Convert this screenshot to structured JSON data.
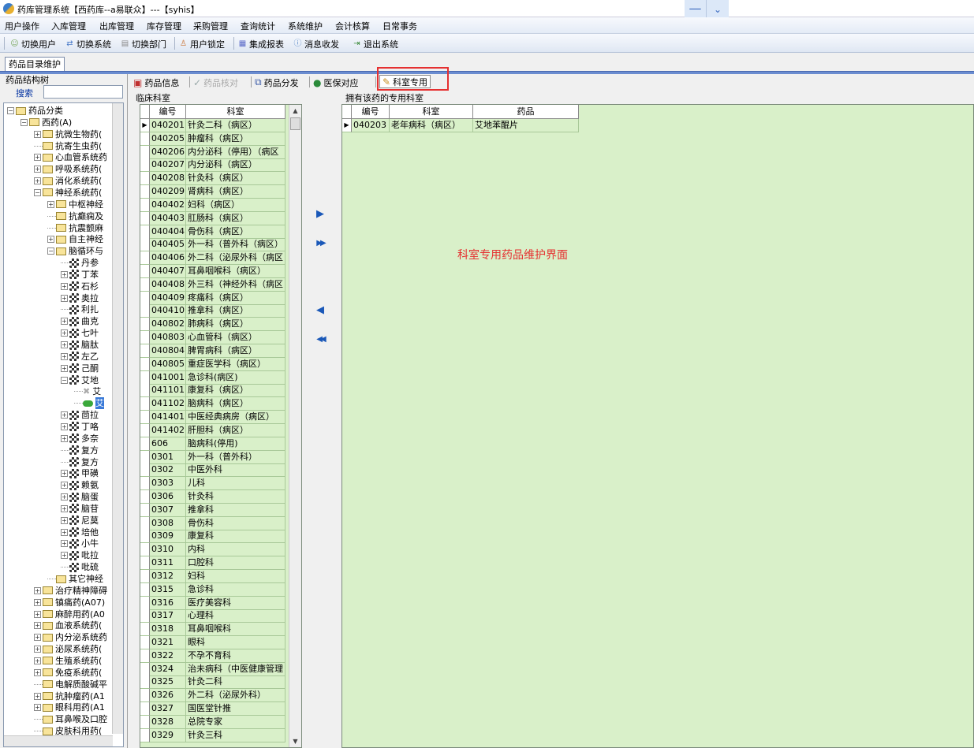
{
  "window": {
    "title": "药库管理系统【西药库--a易联众】---【syhis】",
    "minimize_glyph": "—",
    "dropdown_glyph": "⌄"
  },
  "menubar": {
    "items": [
      "用户操作",
      "入库管理",
      "出库管理",
      "库存管理",
      "采购管理",
      "查询统计",
      "系统维护",
      "会计核算",
      "日常事务"
    ]
  },
  "toolbar": {
    "items": [
      {
        "label": "切换用户",
        "icon": "users-icon"
      },
      {
        "label": "切换系统",
        "icon": "switch-system-icon"
      },
      {
        "label": "切换部门",
        "icon": "department-icon"
      },
      {
        "label": "用户锁定",
        "icon": "lock-user-icon"
      },
      {
        "label": "集成报表",
        "icon": "report-icon"
      },
      {
        "label": "消息收发",
        "icon": "message-icon"
      },
      {
        "label": "退出系统",
        "icon": "exit-icon"
      }
    ]
  },
  "doc_tab": {
    "label": "药品目录维护"
  },
  "tree": {
    "title": "药品结构树",
    "search_label": "搜索",
    "search_value": "",
    "nodes": [
      {
        "label": "药品分类",
        "level": 0,
        "expander": "−",
        "icon": "folder"
      },
      {
        "label": "西药(A)",
        "level": 1,
        "expander": "−",
        "icon": "folder"
      },
      {
        "label": "抗微生物药(",
        "level": 2,
        "expander": "+",
        "icon": "folder"
      },
      {
        "label": "抗寄生虫药(",
        "level": 2,
        "expander": "",
        "icon": "folder"
      },
      {
        "label": "心血管系统药",
        "level": 2,
        "expander": "+",
        "icon": "folder"
      },
      {
        "label": "呼吸系统药(",
        "level": 2,
        "expander": "+",
        "icon": "folder"
      },
      {
        "label": "消化系统药(",
        "level": 2,
        "expander": "+",
        "icon": "folder"
      },
      {
        "label": "神经系统药(",
        "level": 2,
        "expander": "−",
        "icon": "folder"
      },
      {
        "label": "中枢神经",
        "level": 3,
        "expander": "+",
        "icon": "folder"
      },
      {
        "label": "抗癫痫及",
        "level": 3,
        "expander": "",
        "icon": "folder"
      },
      {
        "label": "抗震颤麻",
        "level": 3,
        "expander": "",
        "icon": "folder"
      },
      {
        "label": "自主神经",
        "level": 3,
        "expander": "+",
        "icon": "folder"
      },
      {
        "label": "脑循环与",
        "level": 3,
        "expander": "−",
        "icon": "folder"
      },
      {
        "label": "丹参",
        "level": 4,
        "expander": "",
        "icon": "drug"
      },
      {
        "label": "丁苯",
        "level": 4,
        "expander": "+",
        "icon": "drug"
      },
      {
        "label": "石杉",
        "level": 4,
        "expander": "+",
        "icon": "drug"
      },
      {
        "label": "奥拉",
        "level": 4,
        "expander": "+",
        "icon": "drug"
      },
      {
        "label": "利扎",
        "level": 4,
        "expander": "",
        "icon": "drug"
      },
      {
        "label": "曲克",
        "level": 4,
        "expander": "+",
        "icon": "drug"
      },
      {
        "label": "七叶",
        "level": 4,
        "expander": "+",
        "icon": "drug"
      },
      {
        "label": "脑肽",
        "level": 4,
        "expander": "+",
        "icon": "drug"
      },
      {
        "label": "左乙",
        "level": 4,
        "expander": "+",
        "icon": "drug"
      },
      {
        "label": "己酮",
        "level": 4,
        "expander": "+",
        "icon": "drug"
      },
      {
        "label": "艾地",
        "level": 4,
        "expander": "−",
        "icon": "drug"
      },
      {
        "label": "艾",
        "level": 5,
        "expander": "",
        "icon": "x"
      },
      {
        "label": "艾",
        "level": 5,
        "expander": "",
        "icon": "leaf",
        "selected": true
      },
      {
        "label": "茴拉",
        "level": 4,
        "expander": "+",
        "icon": "drug"
      },
      {
        "label": "丁咯",
        "level": 4,
        "expander": "+",
        "icon": "drug"
      },
      {
        "label": "多奈",
        "level": 4,
        "expander": "+",
        "icon": "drug"
      },
      {
        "label": "复方",
        "level": 4,
        "expander": "",
        "icon": "drug"
      },
      {
        "label": "复方",
        "level": 4,
        "expander": "",
        "icon": "drug"
      },
      {
        "label": "甲磺",
        "level": 4,
        "expander": "+",
        "icon": "drug"
      },
      {
        "label": "赖氨",
        "level": 4,
        "expander": "+",
        "icon": "drug"
      },
      {
        "label": "脑蛋",
        "level": 4,
        "expander": "+",
        "icon": "drug"
      },
      {
        "label": "脑苷",
        "level": 4,
        "expander": "+",
        "icon": "drug"
      },
      {
        "label": "尼莫",
        "level": 4,
        "expander": "+",
        "icon": "drug"
      },
      {
        "label": "培他",
        "level": 4,
        "expander": "+",
        "icon": "drug"
      },
      {
        "label": "小牛",
        "level": 4,
        "expander": "+",
        "icon": "drug"
      },
      {
        "label": "吡拉",
        "level": 4,
        "expander": "+",
        "icon": "drug"
      },
      {
        "label": "吡硫",
        "level": 4,
        "expander": "",
        "icon": "drug"
      },
      {
        "label": "其它神经",
        "level": 3,
        "expander": "",
        "icon": "folder"
      },
      {
        "label": "治疗精神障碍",
        "level": 2,
        "expander": "+",
        "icon": "folder"
      },
      {
        "label": "镇痛药(A07)",
        "level": 2,
        "expander": "+",
        "icon": "folder"
      },
      {
        "label": "麻醉用药(A0",
        "level": 2,
        "expander": "+",
        "icon": "folder"
      },
      {
        "label": "血液系统药(",
        "level": 2,
        "expander": "+",
        "icon": "folder"
      },
      {
        "label": "内分泌系统药",
        "level": 2,
        "expander": "+",
        "icon": "folder"
      },
      {
        "label": "泌尿系统药(",
        "level": 2,
        "expander": "+",
        "icon": "folder"
      },
      {
        "label": "生殖系统药(",
        "level": 2,
        "expander": "+",
        "icon": "folder"
      },
      {
        "label": "免疫系统药(",
        "level": 2,
        "expander": "+",
        "icon": "folder"
      },
      {
        "label": "电解质酸碱平",
        "level": 2,
        "expander": "",
        "icon": "folder"
      },
      {
        "label": "抗肿瘤药(A1",
        "level": 2,
        "expander": "+",
        "icon": "folder"
      },
      {
        "label": "眼科用药(A1",
        "level": 2,
        "expander": "+",
        "icon": "folder"
      },
      {
        "label": "耳鼻喉及口腔",
        "level": 2,
        "expander": "",
        "icon": "folder"
      },
      {
        "label": "皮肤科用药(",
        "level": 2,
        "expander": "",
        "icon": "folder"
      }
    ]
  },
  "subtabs": {
    "items": [
      {
        "label": "药品信息",
        "icon": "drug-info-icon",
        "disabled": false
      },
      {
        "label": "药品核对",
        "icon": "check-icon",
        "disabled": true
      },
      {
        "label": "药品分发",
        "icon": "distribute-icon",
        "disabled": false
      },
      {
        "label": "医保对应",
        "icon": "globe-icon",
        "disabled": false
      },
      {
        "label": "科室专用",
        "icon": "dept-special-icon",
        "disabled": false,
        "active": true
      }
    ]
  },
  "left_panel": {
    "title": "临床科室",
    "columns": [
      "编号",
      "科室"
    ],
    "rows": [
      [
        "040201",
        "针灸二科（病区）"
      ],
      [
        "040205",
        "肿瘤科（病区）"
      ],
      [
        "040206",
        "内分泌科（停用）（病区"
      ],
      [
        "040207",
        "内分泌科（病区）"
      ],
      [
        "040208",
        "针灸科（病区）"
      ],
      [
        "040209",
        "肾病科（病区）"
      ],
      [
        "040402",
        "妇科（病区）"
      ],
      [
        "040403",
        "肛肠科（病区）"
      ],
      [
        "040404",
        "骨伤科（病区）"
      ],
      [
        "040405",
        "外一科（普外科（病区）"
      ],
      [
        "040406",
        "外二科（泌尿外科（病区"
      ],
      [
        "040407",
        "耳鼻咽喉科（病区）"
      ],
      [
        "040408",
        "外三科（神经外科（病区"
      ],
      [
        "040409",
        "疼痛科（病区）"
      ],
      [
        "040410",
        "推拿科（病区）"
      ],
      [
        "040802",
        "肺病科（病区）"
      ],
      [
        "040803",
        "心血管科（病区）"
      ],
      [
        "040804",
        "脾胃病科（病区）"
      ],
      [
        "040805",
        "重症医学科（病区）"
      ],
      [
        "041001",
        "急诊科(病区)"
      ],
      [
        "041101",
        "康复科（病区）"
      ],
      [
        "041102",
        "脑病科（病区）"
      ],
      [
        "041401",
        "中医经典病房（病区）"
      ],
      [
        "041402",
        "肝胆科（病区）"
      ],
      [
        "606",
        "脑病科(停用)"
      ],
      [
        "0301",
        "外一科（普外科）"
      ],
      [
        "0302",
        "中医外科"
      ],
      [
        "0303",
        "儿科"
      ],
      [
        "0306",
        "针灸科"
      ],
      [
        "0307",
        "推拿科"
      ],
      [
        "0308",
        "骨伤科"
      ],
      [
        "0309",
        "康复科"
      ],
      [
        "0310",
        "内科"
      ],
      [
        "0311",
        "口腔科"
      ],
      [
        "0312",
        "妇科"
      ],
      [
        "0315",
        "急诊科"
      ],
      [
        "0316",
        "医疗美容科"
      ],
      [
        "0317",
        "心理科"
      ],
      [
        "0318",
        "耳鼻咽喉科"
      ],
      [
        "0321",
        "眼科"
      ],
      [
        "0322",
        "不孕不育科"
      ],
      [
        "0324",
        "治未病科（中医健康管理"
      ],
      [
        "0325",
        "针灸二科"
      ],
      [
        "0326",
        "外二科（泌尿外科）"
      ],
      [
        "0327",
        "国医堂针推"
      ],
      [
        "0328",
        "总院专家"
      ],
      [
        "0329",
        "针灸三科"
      ]
    ]
  },
  "transfer": {
    "add_one": "▶",
    "add_all": "▶▶",
    "remove_one": "◀",
    "remove_all": "◀◀"
  },
  "right_panel": {
    "title": "拥有该药的专用科室",
    "columns": [
      "编号",
      "科室",
      "药品"
    ],
    "rows": [
      [
        "040203",
        "老年病科（病区）",
        "艾地苯醌片"
      ]
    ]
  },
  "annotation": "科室专用药品维护界面",
  "colors": {
    "grid_bg": "#d9f0c9",
    "highlight": "#e53030",
    "tab_band": "#6a8cd0"
  }
}
